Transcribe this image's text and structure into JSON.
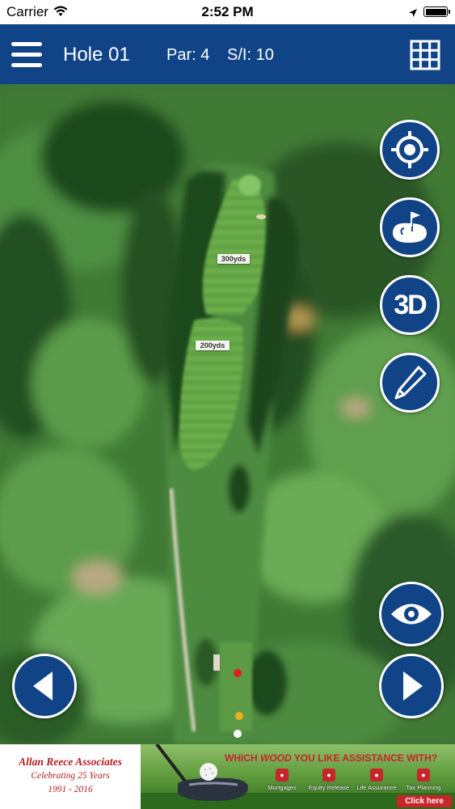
{
  "status_bar": {
    "carrier": "Carrier",
    "time": "2:52 PM"
  },
  "header": {
    "hole_title": "Hole 01",
    "par": "Par:  4",
    "stroke_index": "S/I:  10"
  },
  "map": {
    "yardage_markers": [
      "300yds",
      "200yds"
    ],
    "tee_colors": [
      "#e02020",
      "#e8b020",
      "#ffffff"
    ]
  },
  "controls": {
    "btn_3d_label": "3D",
    "icons": [
      "locate-icon",
      "green-flag-icon",
      "3d-view",
      "pencil-icon",
      "eye-icon",
      "prev-arrow-icon",
      "next-arrow-icon"
    ]
  },
  "ad": {
    "company": "Allan Reece Associates",
    "celebrating": "Celebrating 25 Years",
    "years": "1991 - 2016",
    "headline_pre": "WHICH ",
    "headline_highlight": "WOOD",
    "headline_post": " YOU LIKE ASSISTANCE WITH?",
    "services": [
      "Mortgages",
      "Equity Release",
      "Life Assurance",
      "Tax Planning"
    ],
    "cta": "Click here"
  },
  "colors": {
    "brand_blue": "#114487",
    "ad_red": "#c8252b"
  }
}
